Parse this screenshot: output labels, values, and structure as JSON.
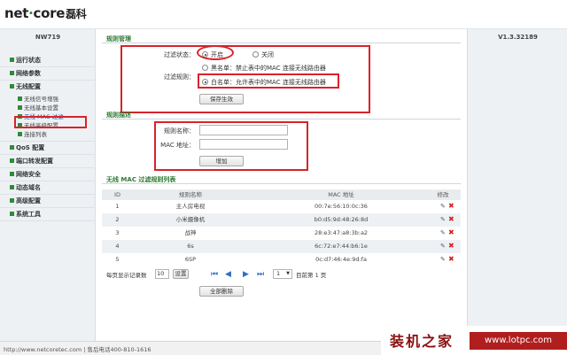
{
  "brand": {
    "logo_left": "net",
    "logo_dot": "·",
    "logo_right": "core",
    "logo_cn": "磊科"
  },
  "left": {
    "model": "NW719",
    "menu": [
      {
        "label": "运行状态"
      },
      {
        "label": "网络参数"
      },
      {
        "label": "无线配置"
      },
      {
        "label": "QoS 配置"
      },
      {
        "label": "端口转发配置"
      },
      {
        "label": "网络安全"
      },
      {
        "label": "动态域名"
      },
      {
        "label": "高级配置"
      },
      {
        "label": "系统工具"
      }
    ],
    "wireless_sub": [
      {
        "label": "无线信号增强"
      },
      {
        "label": "无线基本设置"
      },
      {
        "label": "无线 MAC 过滤"
      },
      {
        "label": "无线高级配置"
      },
      {
        "label": "连接列表"
      }
    ]
  },
  "right": {
    "version": "V1.3.32189"
  },
  "rule_mgmt": {
    "title": "规则管理",
    "filter_status_label": "过滤状态：",
    "on_label": "开启",
    "off_label": "关闭",
    "filter_rule_label": "过滤规则：",
    "blacklist_label": "黑名单：禁止表中的MAC 连接无线路由器",
    "whitelist_label": "白名单：允许表中的MAC 连接无线路由器",
    "save_label": "保存生效"
  },
  "rule_desc": {
    "title": "规则描述",
    "name_label": "规则名称：",
    "mac_label": "MAC 地址：",
    "name_value": "",
    "mac_value": "",
    "add_label": "增加"
  },
  "list": {
    "title": "无线 MAC 过滤规则列表",
    "headers": {
      "id": "ID",
      "name": "规则名称",
      "mac": "MAC 地址",
      "edit": "修改"
    },
    "rows": [
      {
        "id": "1",
        "name": "主人房电视",
        "mac": "00:7e:56:10:0c:36"
      },
      {
        "id": "2",
        "name": "小米摄像机",
        "mac": "b0:d5:9d:48:26:8d"
      },
      {
        "id": "3",
        "name": "战神",
        "mac": "28:e3:47:a8:3b:a2"
      },
      {
        "id": "4",
        "name": "6s",
        "mac": "6c:72:e7:44:b6:1e"
      },
      {
        "id": "5",
        "name": "6SP",
        "mac": "0c:d7:46:4e:9d:fa"
      }
    ],
    "per_page_label": "每页显示记录数",
    "per_page_value": "10",
    "set_label": "设置",
    "page_select": "1",
    "page_info": "目前第 1 页",
    "delete_all_label": "全部删除"
  },
  "footer": {
    "text": "http://www.netcoretec.com | 售后电话400-810-1616"
  },
  "watermark": {
    "cn": "装机之家",
    "url": "www.lotpc.com"
  },
  "colors": {
    "accent": "#2f7a35",
    "highlight": "#d8232a",
    "sidebar": "#eef1f4"
  }
}
